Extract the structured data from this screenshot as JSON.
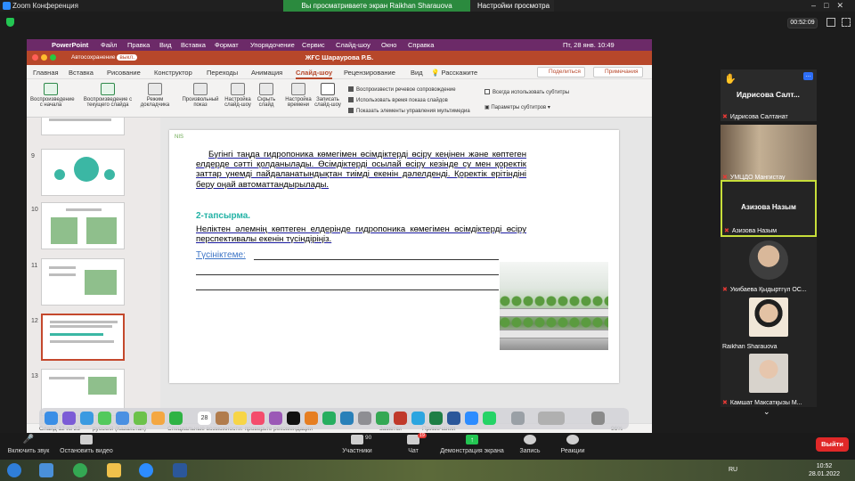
{
  "zoom": {
    "window_title": "Zoom Конференция",
    "share_banner": "Вы просматриваете экран Raikhan Sharauova",
    "view_options": "Настройки просмотра",
    "timer": "00:52:09"
  },
  "mac": {
    "app": "PowerPoint",
    "menu": [
      "Файл",
      "Правка",
      "Вид",
      "Вставка",
      "Формат",
      "Упорядочение",
      "Сервис",
      "Слайд-шоу",
      "Окно",
      "Справка"
    ],
    "datetime": "Пт, 28 янв. 10:49"
  },
  "ppt": {
    "autosave_label": "Автосохранение",
    "autosave_state": "выкл.",
    "filename": "ЖҒС Шараурова Р.Б.",
    "tabs": [
      "Главная",
      "Вставка",
      "Рисование",
      "Конструктор",
      "Переходы",
      "Анимация",
      "Слайд-шоу",
      "Рецензирование",
      "Вид"
    ],
    "active_tab": "Слайд-шоу",
    "tell_me": "Расскажите",
    "share_button": "Поделиться",
    "comments_button": "Примечания",
    "ribbon": {
      "from_start": "Воспроизведение с начала",
      "from_current": "Воспроизведение с текущего слайда",
      "presenter": "Режим докладчика",
      "custom_show": "Произвольный показ",
      "setup_show": "Настройка слайд-шоу",
      "hide_slide": "Скрыть слайд",
      "rehearse": "Настройка времени",
      "record": "Записать слайд-шоу",
      "opt_narration": "Воспроизвести речевое сопровождение",
      "opt_timings": "Использовать время показа слайдов",
      "opt_media": "Показать элементы управления мультимедиа",
      "opt_subtitles": "Всегда использовать субтитры",
      "subtitle_settings": "Параметры субтитров"
    },
    "thumbnails": [
      "9",
      "10",
      "11",
      "12",
      "13"
    ],
    "selected_slide": "12",
    "slide": {
      "logo": "NIS",
      "paragraph": "Бүгінгі таңда гидропоника көмегімен өсімдіктерді өсіру кеңінен және көптеген елдерде сәтті қолданылады. Өсімдіктерді осылай өсіру кезінде су мен қоректік заттар үнемді пайдаланатындықтан тиімді екенін дәлелденді. Қоректік ерітіндіні беру оңай автоматтандырылады.",
      "task_heading": "2-тапсырма.",
      "task_text": "Неліктен әлемнің көптеген елдерінде гидропоника көмегімен өсімдіктерді өсіру перспективалы екенін түсіндіріңіз.",
      "explain_label": "Түсініктеме:"
    },
    "status": {
      "slide_count": "Слайд 12 из 23",
      "language": "русский (Казахстан)",
      "accessibility": "Специальные возможности: проверьте рекомендации",
      "notes": "Заметки",
      "comments": "Примечания",
      "zoom": "96%"
    },
    "dock_date": "28"
  },
  "participants": [
    {
      "name": "Идрисова Салтанат",
      "display": "Идрисова Салт...",
      "muted": true
    },
    {
      "name": "УМЦДО Мангистау",
      "muted": true
    },
    {
      "name": "Азизова Назым",
      "display": "Азизова Назым",
      "muted": true
    },
    {
      "name": "Укибаева Қыдыртгүл ОС...",
      "muted": true
    },
    {
      "name": "Raikhan Sharauova",
      "muted": false
    },
    {
      "name": "Камшат Максатқызы М...",
      "muted": true
    }
  ],
  "toolbar": {
    "mute": "Включить звук",
    "video": "Остановить видео",
    "participants": "Участники",
    "participants_count": "90",
    "chat": "Чат",
    "chat_badge": "19",
    "share": "Демонстрация экрана",
    "record": "Запись",
    "reactions": "Реакции",
    "end": "Выйти"
  },
  "taskbar": {
    "lang": "RU",
    "time": "10:52",
    "date": "28.01.2022"
  }
}
